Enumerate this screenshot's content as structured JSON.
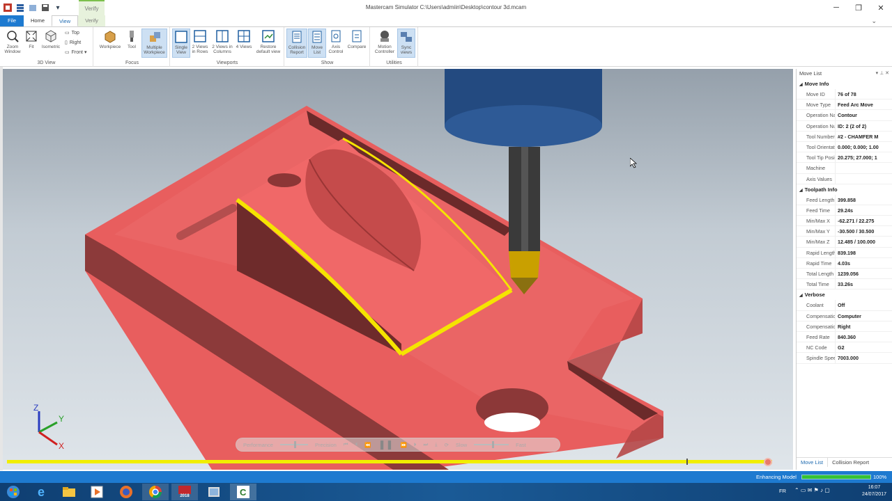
{
  "window": {
    "title": "Mastercam Simulator  C:\\Users\\admiin\\Desktop\\contour 3d.mcam",
    "context_tab": "Verify"
  },
  "tabs": [
    {
      "label": "File"
    },
    {
      "label": "Home"
    },
    {
      "label": "View"
    },
    {
      "label": "Verify"
    }
  ],
  "ribbon": {
    "view3d": {
      "label": "3D View",
      "zoom_window": "Zoom Window",
      "fit": "Fit",
      "isometric": "Isometric",
      "top": "Top",
      "right": "Right",
      "front": "Front"
    },
    "focus": {
      "label": "Focus",
      "workpiece": "Workpiece",
      "tool": "Tool",
      "multiple_workpiece": "Multiple Workpiece"
    },
    "viewports": {
      "label": "Viewports",
      "single": "Single View",
      "rows": "2 Views in Rows",
      "columns": "2 Views in Columns",
      "four": "4 Views",
      "restore": "Restore default view"
    },
    "show": {
      "label": "Show",
      "collision": "Collision Report",
      "movelist": "Move List",
      "axis": "Axis Control",
      "compare": "Compare"
    },
    "utilities": {
      "label": "Utilities",
      "motion": "Motion Controller",
      "sync": "Sync views"
    }
  },
  "playback": {
    "performance": "Performance",
    "precision": "Precision",
    "slow": "Slow",
    "fast": "Fast",
    "progress": 0.993
  },
  "axes": {
    "z": "Z",
    "y": "Y",
    "x": "X"
  },
  "panel": {
    "title": "Move List",
    "sections": [
      {
        "title": "Move Info",
        "rows": [
          {
            "k": "Move ID",
            "v": "76 of 78"
          },
          {
            "k": "Move Type",
            "v": "Feed Arc Move"
          },
          {
            "k": "Operation Na",
            "v": "Contour"
          },
          {
            "k": "Operation Nu",
            "v": "ID: 2 (2 of 2)"
          },
          {
            "k": "Tool Number",
            "v": "#2 - CHAMFER M"
          },
          {
            "k": "Tool Orientati",
            "v": "0.000; 0.000; 1.00"
          },
          {
            "k": "Tool Tip Posit",
            "v": "20.275; 27.000; 1"
          },
          {
            "k": "Machine",
            "v": ""
          },
          {
            "k": "Axis Values",
            "v": ""
          }
        ]
      },
      {
        "title": "Toolpath Info",
        "rows": [
          {
            "k": "Feed Length",
            "v": "399.858"
          },
          {
            "k": "Feed Time",
            "v": "29.24s"
          },
          {
            "k": "Min/Max X",
            "v": "-62.271 / 22.275"
          },
          {
            "k": "Min/Max Y",
            "v": "-30.500 / 30.500"
          },
          {
            "k": "Min/Max Z",
            "v": "12.485 / 100.000"
          },
          {
            "k": "Rapid Length",
            "v": "839.198"
          },
          {
            "k": "Rapid Time",
            "v": "4.03s"
          },
          {
            "k": "Total Length",
            "v": "1239.056"
          },
          {
            "k": "Total Time",
            "v": "33.26s"
          }
        ]
      },
      {
        "title": "Verbose",
        "rows": [
          {
            "k": "Coolant",
            "v": "Off"
          },
          {
            "k": "Compensation",
            "v": "Computer"
          },
          {
            "k": "Compensation",
            "v": "Right"
          },
          {
            "k": "Feed Rate",
            "v": "840.360"
          },
          {
            "k": "NC Code",
            "v": "G2"
          },
          {
            "k": "Spindle Speec",
            "v": "7003.000"
          }
        ]
      }
    ],
    "bottom_tabs": [
      "Move List",
      "Collision Report"
    ]
  },
  "status": {
    "label": "Enhancing Model",
    "percent": "100%",
    "progress": 1.0
  },
  "taskbar": {
    "lang": "FR",
    "time": "16:07",
    "date": "24/07/2017",
    "app_badge": "2018"
  }
}
